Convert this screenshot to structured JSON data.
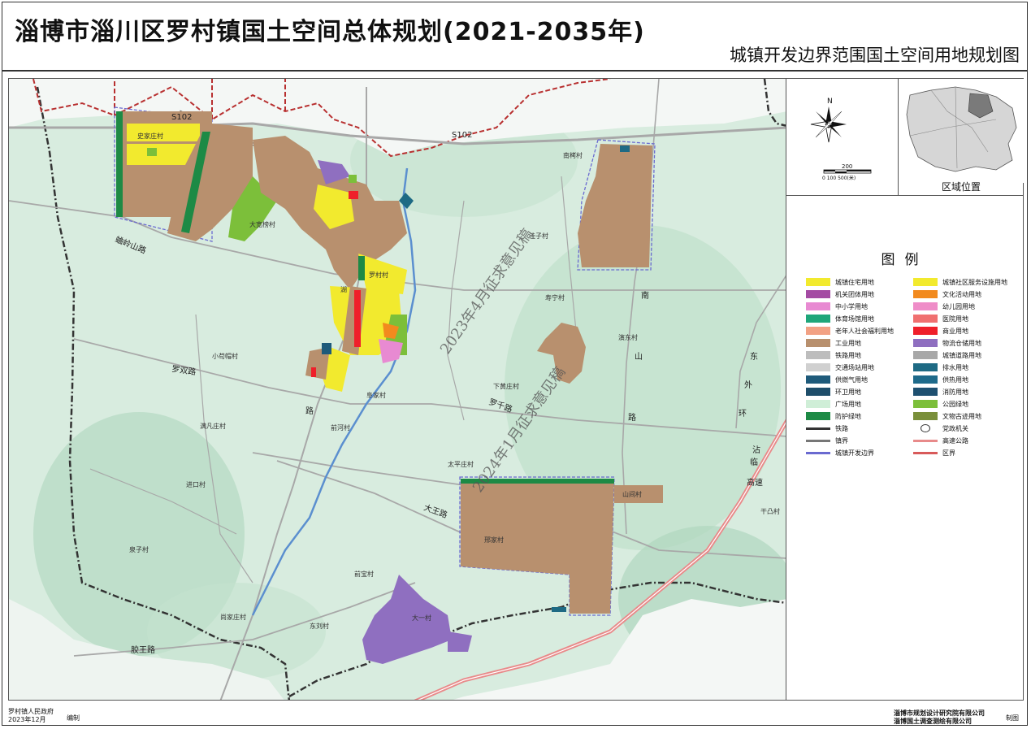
{
  "header": {
    "title": "淄博市淄川区罗村镇国土空间总体规划(2021-2035年)",
    "subtitle": "城镇开发边界范围国土空间用地规划图"
  },
  "map": {
    "roads": {
      "s102_west": "S102",
      "s102_east": "S102",
      "shiling": "蛐岭山路",
      "luoshuang": "罗双路",
      "lu": "路",
      "luoqian": "罗千路",
      "dawang": "大王路",
      "jiaowang": "胶王路",
      "nan": "南",
      "shan": "山",
      "lu2": "路",
      "dong": "东",
      "wai": "外",
      "huan": "环",
      "zilin": "淄临",
      "gaosu": "高速",
      "zilin2": "沾",
      "gaosu2": "临"
    },
    "villages": {
      "shijiazhuang": "史家庄村",
      "daxinzhuang": "大宽榜村",
      "nanzhuang": "南栲村",
      "wa": "洼子村",
      "luocun": "罗村村",
      "hu": "湖",
      "xiaowang": "小苟帽村",
      "fuxin": "阜家村",
      "xiahuangzhuang": "下黄庄村",
      "shouxing": "寿宁村",
      "dongcun": "演东村",
      "hexi": "前河村",
      "taiping": "太平庄村",
      "manzhuang": "满凡庄村",
      "jinkou": "进口村",
      "shanjian": "山间村",
      "xingjia": "邢家村",
      "qianqiao": "前宝村",
      "qiantian": "干凸村",
      "quanzi": "泉子村",
      "shangjia": "尚家庄村",
      "dongcun2": "东刘村",
      "dacun": "大一村",
      "shanjia": "山家庄村"
    },
    "watermark1": "2023年4月征求意见稿",
    "watermark2": "2024年1月征求意见稿"
  },
  "compass": {
    "north": "N",
    "scale_top": "200",
    "scale_bottom": "0 100        500(米)"
  },
  "location": {
    "label": "区域位置"
  },
  "legend": {
    "title": "图例",
    "left": [
      {
        "label": "城镇住宅用地",
        "color": "#f2ea2e"
      },
      {
        "label": "机关团体用地",
        "color": "#a44ba3"
      },
      {
        "label": "中小学用地",
        "color": "#e88ad2"
      },
      {
        "label": "体育场馆用地",
        "color": "#1fa67a"
      },
      {
        "label": "老年人社会福利用地",
        "color": "#f2a184"
      },
      {
        "label": "工业用地",
        "color": "#b8906e"
      },
      {
        "label": "铁路用地",
        "color": "#bdbdbd"
      },
      {
        "label": "交通场站用地",
        "color": "#d0d0d0"
      },
      {
        "label": "供燃气用地",
        "color": "#1e5a7a"
      },
      {
        "label": "环卫用地",
        "color": "#1e4e6a"
      },
      {
        "label": "广场用地",
        "color": "#cfeed7"
      },
      {
        "label": "防护绿地",
        "color": "#1d8a45"
      },
      {
        "label": "铁路",
        "color": "#333333"
      },
      {
        "label": "镇界",
        "color": "#777777"
      },
      {
        "label": "城镇开发边界",
        "color": "#6a6ad0"
      }
    ],
    "right": [
      {
        "label": "城镇社区服务设施用地",
        "color": "#f2ea2e"
      },
      {
        "label": "文化活动用地",
        "color": "#f28a1e"
      },
      {
        "label": "幼儿园用地",
        "color": "#ef8dc8"
      },
      {
        "label": "医院用地",
        "color": "#f07070"
      },
      {
        "label": "商业用地",
        "color": "#ef1f2a"
      },
      {
        "label": "物流仓储用地",
        "color": "#8f6fc0"
      },
      {
        "label": "城镇道路用地",
        "color": "#a8a8a8"
      },
      {
        "label": "排水用地",
        "color": "#1e6a84"
      },
      {
        "label": "供热用地",
        "color": "#1e6a8a"
      },
      {
        "label": "消防用地",
        "color": "#1e5070"
      },
      {
        "label": "公园绿地",
        "color": "#7cbf3a"
      },
      {
        "label": "文物古迹用地",
        "color": "#7a8f3a"
      },
      {
        "label": "党政机关",
        "color": "#ffffff"
      },
      {
        "label": "高速公路",
        "color": "#e88a8a"
      },
      {
        "label": "区界",
        "color": "#d85a5a"
      }
    ]
  },
  "footer": {
    "gov": "罗村镇人民政府",
    "date": "2023年12月",
    "edit": "编制",
    "org1": "淄博市规划设计研究院有限公司",
    "org2": "淄博国土调查测绘有限公司",
    "make": "制图"
  },
  "colors": {
    "industrial": "#b8906e",
    "residential": "#f2ea2e",
    "green": "#1d8a45",
    "park": "#7cbf3a",
    "water": "#5b8fcf",
    "boundary_red": "#b83030",
    "terrain": "#d6ecdf"
  }
}
